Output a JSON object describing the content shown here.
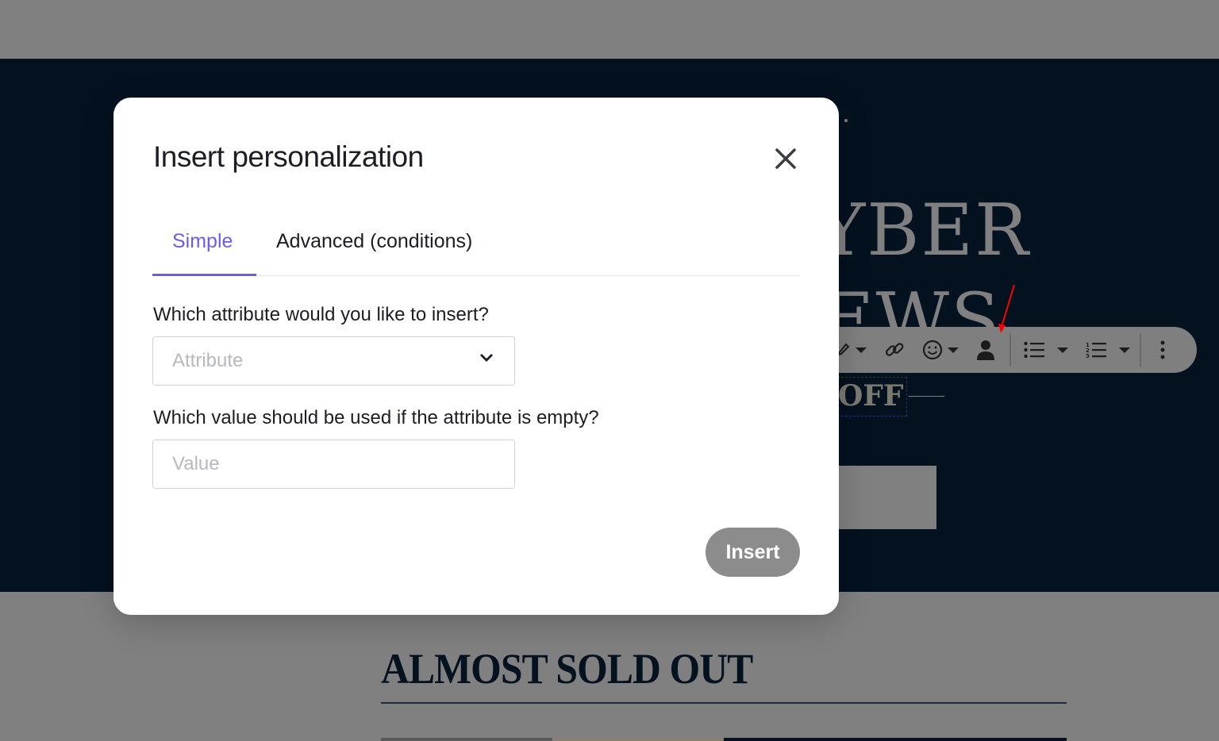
{
  "background": {
    "hero_line1": "CYBER",
    "hero_line2": "NEWS",
    "offer": "OFF",
    "section_title": "ALMOST SOLD OUT"
  },
  "toolbar": {
    "items": [
      "highlight-icon",
      "link-icon",
      "emoji-icon",
      "personalization-icon",
      "bulleted-list-icon",
      "numbered-list-icon",
      "more-icon"
    ]
  },
  "modal": {
    "title": "Insert personalization",
    "tabs": [
      {
        "label": "Simple",
        "active": true
      },
      {
        "label": "Advanced (conditions)",
        "active": false
      }
    ],
    "attribute_label": "Which attribute would you like to insert?",
    "attribute_placeholder": "Attribute",
    "value_label": "Which value should be used if the attribute is empty?",
    "value_placeholder": "Value",
    "insert_label": "Insert"
  },
  "colors": {
    "accent": "#6c5ce7",
    "overlay": "#808080",
    "navy": "#04111f",
    "annotation": "#ff0000"
  }
}
